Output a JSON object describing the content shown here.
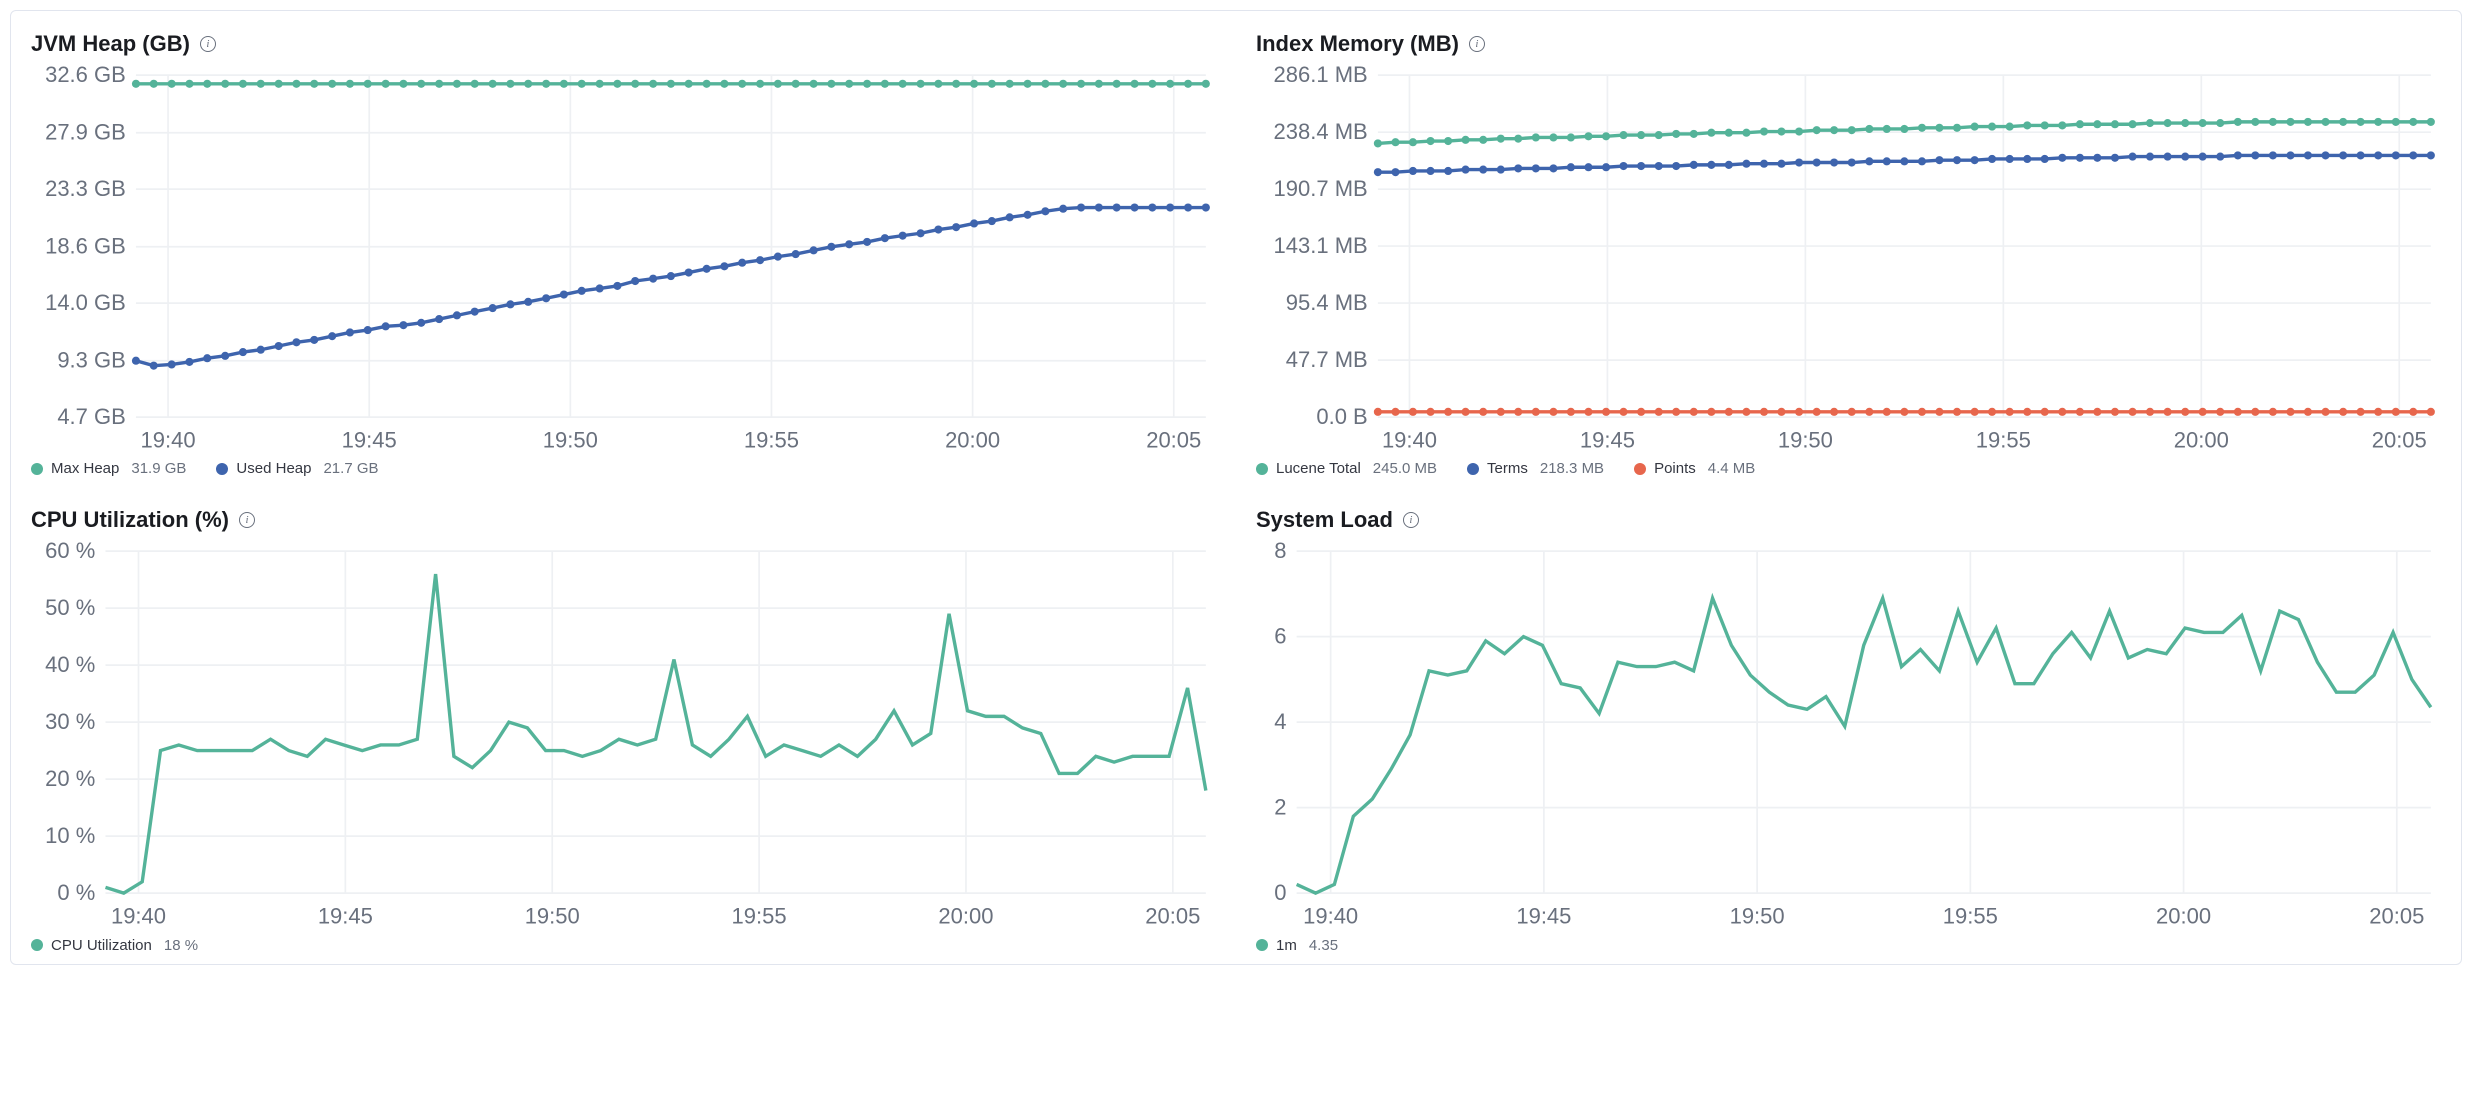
{
  "colors": {
    "teal": "#54b399",
    "blue": "#3e64ad",
    "orange": "#e7664c",
    "grid": "#eef0f3",
    "axis_text": "#69707d"
  },
  "x_categories": [
    "19:40",
    "19:45",
    "19:50",
    "19:55",
    "20:00",
    "20:05"
  ],
  "panels": {
    "heap": {
      "title": "JVM Heap (GB)",
      "legend": [
        {
          "name": "Max Heap",
          "value": "31.9 GB",
          "color": "teal"
        },
        {
          "name": "Used Heap",
          "value": "21.7 GB",
          "color": "blue"
        }
      ]
    },
    "index_mem": {
      "title": "Index Memory (MB)",
      "legend": [
        {
          "name": "Lucene Total",
          "value": "245.0 MB",
          "color": "teal"
        },
        {
          "name": "Terms",
          "value": "218.3 MB",
          "color": "blue"
        },
        {
          "name": "Points",
          "value": "4.4 MB",
          "color": "orange"
        }
      ]
    },
    "cpu": {
      "title": "CPU Utilization (%)",
      "legend": [
        {
          "name": "CPU Utilization",
          "value": "18 %",
          "color": "teal"
        }
      ]
    },
    "load": {
      "title": "System Load",
      "legend": [
        {
          "name": "1m",
          "value": "4.35",
          "color": "teal"
        }
      ]
    }
  },
  "chart_data": [
    {
      "id": "heap",
      "type": "line",
      "title": "JVM Heap (GB)",
      "xlabel": "",
      "ylabel": "",
      "ylim": [
        4.7,
        32.6
      ],
      "yticks": [
        4.7,
        9.3,
        14.0,
        18.6,
        23.3,
        27.9,
        32.6
      ],
      "ytick_labels": [
        "4.7 GB",
        "9.3 GB",
        "14.0 GB",
        "18.6 GB",
        "23.3 GB",
        "27.9 GB",
        "32.6 GB"
      ],
      "x_ticks": [
        "19:40",
        "19:45",
        "19:50",
        "19:55",
        "20:00",
        "20:05"
      ],
      "series": [
        {
          "name": "Max Heap",
          "color": "teal",
          "dots": true,
          "values": [
            31.9,
            31.9,
            31.9,
            31.9,
            31.9,
            31.9,
            31.9,
            31.9,
            31.9,
            31.9,
            31.9,
            31.9,
            31.9,
            31.9,
            31.9,
            31.9,
            31.9,
            31.9,
            31.9,
            31.9,
            31.9,
            31.9,
            31.9,
            31.9,
            31.9,
            31.9,
            31.9,
            31.9,
            31.9,
            31.9,
            31.9,
            31.9,
            31.9,
            31.9,
            31.9,
            31.9,
            31.9,
            31.9,
            31.9,
            31.9,
            31.9,
            31.9,
            31.9,
            31.9,
            31.9,
            31.9,
            31.9,
            31.9,
            31.9,
            31.9,
            31.9,
            31.9,
            31.9,
            31.9,
            31.9,
            31.9,
            31.9,
            31.9,
            31.9,
            31.9,
            31.9
          ]
        },
        {
          "name": "Used Heap",
          "color": "blue",
          "dots": true,
          "values": [
            9.3,
            8.9,
            9.0,
            9.2,
            9.5,
            9.7,
            10.0,
            10.2,
            10.5,
            10.8,
            11.0,
            11.3,
            11.6,
            11.8,
            12.1,
            12.2,
            12.4,
            12.7,
            13.0,
            13.3,
            13.6,
            13.9,
            14.1,
            14.4,
            14.7,
            15.0,
            15.2,
            15.4,
            15.8,
            16.0,
            16.2,
            16.5,
            16.8,
            17.0,
            17.3,
            17.5,
            17.8,
            18.0,
            18.3,
            18.6,
            18.8,
            19.0,
            19.3,
            19.5,
            19.7,
            20.0,
            20.2,
            20.5,
            20.7,
            21.0,
            21.2,
            21.5,
            21.7,
            21.8,
            21.8,
            21.8,
            21.8,
            21.8,
            21.8,
            21.8,
            21.8
          ]
        }
      ]
    },
    {
      "id": "index_mem",
      "type": "line",
      "title": "Index Memory (MB)",
      "xlabel": "",
      "ylabel": "",
      "ylim": [
        0,
        286.1
      ],
      "yticks": [
        0,
        47.7,
        95.4,
        143.1,
        190.7,
        238.4,
        286.1
      ],
      "ytick_labels": [
        "0.0 B",
        "47.7 MB",
        "95.4 MB",
        "143.1 MB",
        "190.7 MB",
        "238.4 MB",
        "286.1 MB"
      ],
      "x_ticks": [
        "19:40",
        "19:45",
        "19:50",
        "19:55",
        "20:00",
        "20:05"
      ],
      "series": [
        {
          "name": "Lucene Total",
          "color": "teal",
          "dots": true,
          "values": [
            229,
            230,
            230,
            231,
            231,
            232,
            232,
            233,
            233,
            234,
            234,
            234,
            235,
            235,
            236,
            236,
            236,
            237,
            237,
            238,
            238,
            238,
            239,
            239,
            239,
            240,
            240,
            240,
            241,
            241,
            241,
            242,
            242,
            242,
            243,
            243,
            243,
            244,
            244,
            244,
            245,
            245,
            245,
            245,
            246,
            246,
            246,
            246,
            246,
            247,
            247,
            247,
            247,
            247,
            247,
            247,
            247,
            247,
            247,
            247,
            247
          ]
        },
        {
          "name": "Terms",
          "color": "blue",
          "dots": true,
          "values": [
            205,
            205,
            206,
            206,
            206,
            207,
            207,
            207,
            208,
            208,
            208,
            209,
            209,
            209,
            210,
            210,
            210,
            210,
            211,
            211,
            211,
            212,
            212,
            212,
            213,
            213,
            213,
            213,
            214,
            214,
            214,
            214,
            215,
            215,
            215,
            216,
            216,
            216,
            216,
            217,
            217,
            217,
            217,
            218,
            218,
            218,
            218,
            218,
            218,
            219,
            219,
            219,
            219,
            219,
            219,
            219,
            219,
            219,
            219,
            219,
            219
          ]
        },
        {
          "name": "Points",
          "color": "orange",
          "dots": true,
          "values": [
            4.4,
            4.4,
            4.4,
            4.4,
            4.4,
            4.4,
            4.4,
            4.4,
            4.4,
            4.4,
            4.4,
            4.4,
            4.4,
            4.4,
            4.4,
            4.4,
            4.4,
            4.4,
            4.4,
            4.4,
            4.4,
            4.4,
            4.4,
            4.4,
            4.4,
            4.4,
            4.4,
            4.4,
            4.4,
            4.4,
            4.4,
            4.4,
            4.4,
            4.4,
            4.4,
            4.4,
            4.4,
            4.4,
            4.4,
            4.4,
            4.4,
            4.4,
            4.4,
            4.4,
            4.4,
            4.4,
            4.4,
            4.4,
            4.4,
            4.4,
            4.4,
            4.4,
            4.4,
            4.4,
            4.4,
            4.4,
            4.4,
            4.4,
            4.4,
            4.4,
            4.4
          ]
        }
      ]
    },
    {
      "id": "cpu",
      "type": "line",
      "title": "CPU Utilization (%)",
      "xlabel": "",
      "ylabel": "",
      "ylim": [
        0,
        60
      ],
      "yticks": [
        0,
        10,
        20,
        30,
        40,
        50,
        60
      ],
      "ytick_labels": [
        "0 %",
        "10 %",
        "20 %",
        "30 %",
        "40 %",
        "50 %",
        "60 %"
      ],
      "x_ticks": [
        "19:40",
        "19:45",
        "19:50",
        "19:55",
        "20:00",
        "20:05"
      ],
      "series": [
        {
          "name": "CPU Utilization",
          "color": "teal",
          "dots": false,
          "values": [
            1,
            0,
            2,
            25,
            26,
            25,
            25,
            25,
            25,
            27,
            25,
            24,
            27,
            26,
            25,
            26,
            26,
            27,
            56,
            24,
            22,
            25,
            30,
            29,
            25,
            25,
            24,
            25,
            27,
            26,
            27,
            41,
            26,
            24,
            27,
            31,
            24,
            26,
            25,
            24,
            26,
            24,
            27,
            32,
            26,
            28,
            49,
            32,
            31,
            31,
            29,
            28,
            21,
            21,
            24,
            23,
            24,
            24,
            24,
            36,
            18
          ]
        }
      ]
    },
    {
      "id": "load",
      "type": "line",
      "title": "System Load",
      "xlabel": "",
      "ylabel": "",
      "ylim": [
        0,
        8
      ],
      "yticks": [
        0,
        2,
        4,
        6,
        8
      ],
      "ytick_labels": [
        "0",
        "2",
        "4",
        "6",
        "8"
      ],
      "x_ticks": [
        "19:40",
        "19:45",
        "19:50",
        "19:55",
        "20:00",
        "20:05"
      ],
      "series": [
        {
          "name": "1m",
          "color": "teal",
          "dots": false,
          "values": [
            0.2,
            0.0,
            0.2,
            1.8,
            2.2,
            2.9,
            3.7,
            5.2,
            5.1,
            5.2,
            5.9,
            5.6,
            6.0,
            5.8,
            4.9,
            4.8,
            4.2,
            5.4,
            5.3,
            5.3,
            5.4,
            5.2,
            6.9,
            5.8,
            5.1,
            4.7,
            4.4,
            4.3,
            4.6,
            3.9,
            5.8,
            6.9,
            5.3,
            5.7,
            5.2,
            6.6,
            5.4,
            6.2,
            4.9,
            4.9,
            5.6,
            6.1,
            5.5,
            6.6,
            5.5,
            5.7,
            5.6,
            6.2,
            6.1,
            6.1,
            6.5,
            5.2,
            6.6,
            6.4,
            5.4,
            4.7,
            4.7,
            5.1,
            6.1,
            5.0,
            4.35
          ]
        }
      ]
    }
  ]
}
